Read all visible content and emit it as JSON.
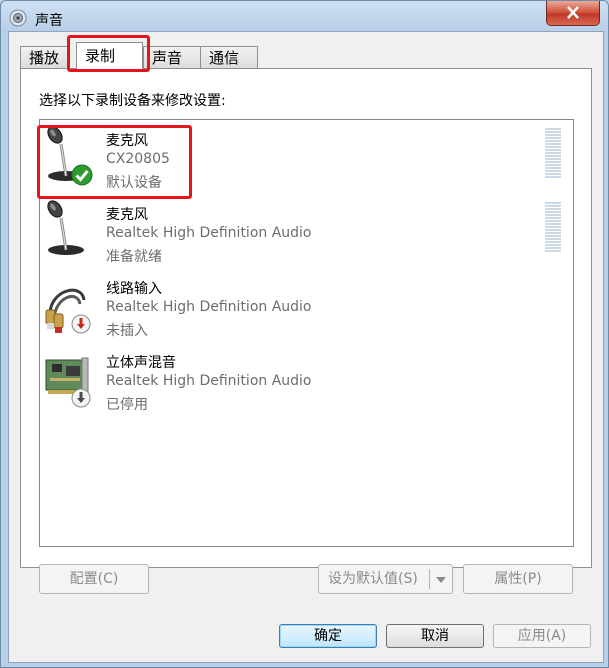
{
  "window": {
    "title": "声音",
    "close_glyph": "✕"
  },
  "tabs": [
    {
      "label": "播放"
    },
    {
      "label": "录制"
    },
    {
      "label": "声音"
    },
    {
      "label": "通信"
    }
  ],
  "panel": {
    "instruction": "选择以下录制设备来修改设置:",
    "devices": [
      {
        "name": "麦克风",
        "description": "CX20805",
        "status": "默认设备",
        "icon": "microphone-icon",
        "badge": "default-check-icon"
      },
      {
        "name": "麦克风",
        "description": "Realtek High Definition Audio",
        "status": "准备就绪",
        "icon": "microphone-icon",
        "badge": ""
      },
      {
        "name": "线路输入",
        "description": "Realtek High Definition Audio",
        "status": "未插入",
        "icon": "rca-cable-icon",
        "badge": "unplugged-icon"
      },
      {
        "name": "立体声混音",
        "description": "Realtek High Definition Audio",
        "status": "已停用",
        "icon": "sound-card-icon",
        "badge": "disabled-icon"
      }
    ]
  },
  "buttons": {
    "configure": "配置(C)",
    "set_default": "设为默认值(S)",
    "properties": "属性(P)",
    "ok": "确定",
    "cancel": "取消",
    "apply": "应用(A)"
  },
  "colors": {
    "highlight": "#e8141b",
    "check_green": "#2e9b2e",
    "status_red": "#c42b1c"
  }
}
